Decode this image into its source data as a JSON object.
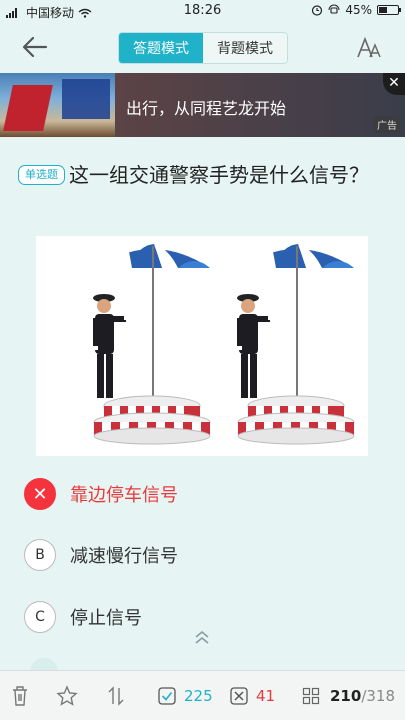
{
  "status_bar": {
    "carrier": "中国移动",
    "time": "18:26",
    "battery": "45%",
    "battery_level": 0.45
  },
  "header": {
    "tabs": [
      {
        "label": "答题模式",
        "active": true
      },
      {
        "label": "背题模式",
        "active": false
      }
    ]
  },
  "ad": {
    "text": "出行，从同程艺龙开始",
    "tag": "广告",
    "close_symbol": "✕"
  },
  "question": {
    "type_badge": "单选题",
    "text": "这一组交通警察手势是什么信号？"
  },
  "options": [
    {
      "marker": "✕",
      "text": "靠边停车信号",
      "state": "wrong"
    },
    {
      "marker": "B",
      "text": "减速慢行信号",
      "state": "normal"
    },
    {
      "marker": "C",
      "text": "停止信号",
      "state": "normal"
    }
  ],
  "bottom_bar": {
    "correct_count": "225",
    "wrong_count": "41",
    "current": "210",
    "total": "/318"
  },
  "colors": {
    "accent": "#1fb2c8",
    "wrong": "#f4333c",
    "background": "#e6f4f3"
  }
}
